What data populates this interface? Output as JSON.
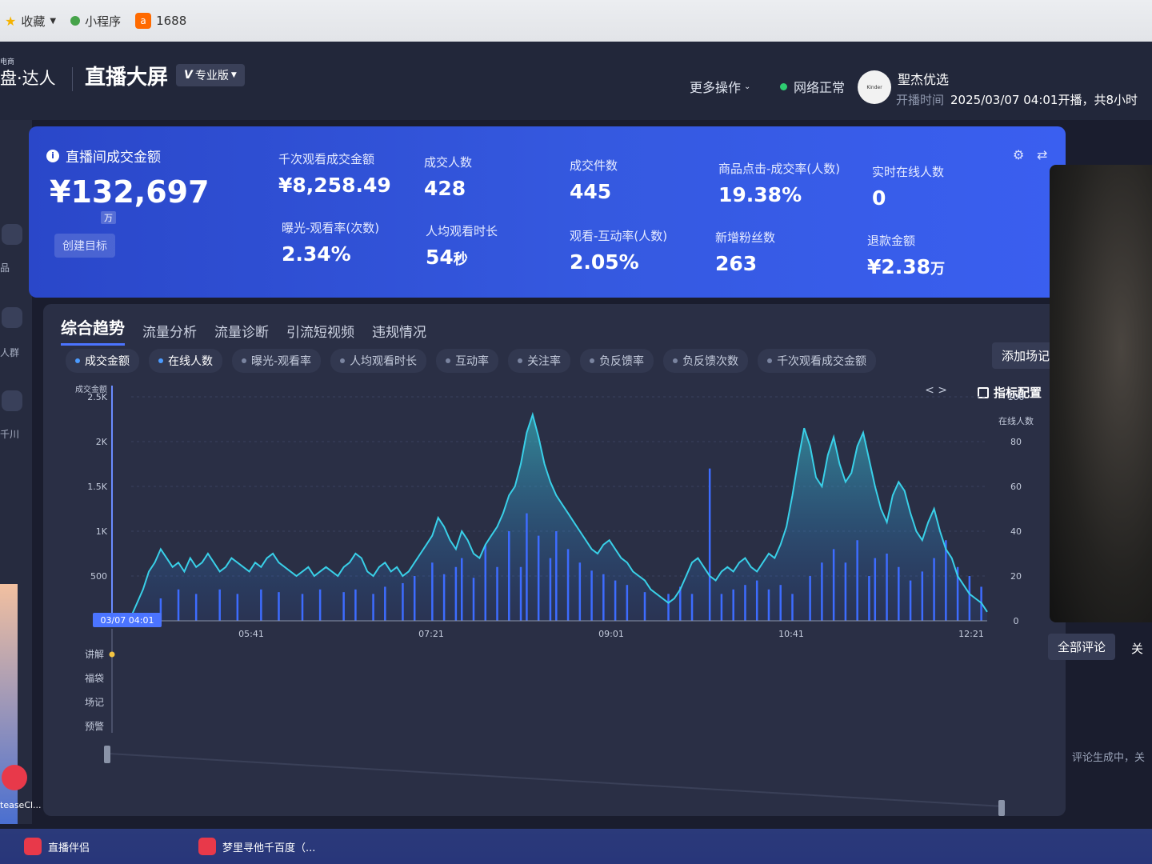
{
  "bookmarks": {
    "items": [
      {
        "label": "收藏",
        "icon": "star-icon"
      },
      {
        "label": "小程序",
        "icon": "mini-program-icon"
      },
      {
        "label": "1688",
        "icon": "1688-icon"
      }
    ]
  },
  "header": {
    "brand_small": "电商",
    "brand": "盘·达人",
    "title": "直播大屏",
    "edition": "专业版",
    "edition_v": "V",
    "more_ops": "更多操作",
    "net_status": "网络正常",
    "avatar_text": "Kinder",
    "shop_name": "聖杰优选",
    "live_time_label": "开播时间",
    "live_time_value": "2025/03/07 04:01开播，共8小时"
  },
  "left_rail": {
    "items": [
      "品",
      "人群",
      "千川"
    ]
  },
  "metrics": {
    "main_title": "直播间成交金额",
    "main_value": "¥132,697",
    "main_unit": "万",
    "create_goal": "创建目标",
    "items": [
      {
        "label": "千次观看成交金额",
        "value": "¥8,258.49"
      },
      {
        "label": "成交人数",
        "value": "428"
      },
      {
        "label": "成交件数",
        "value": "445"
      },
      {
        "label": "商品点击-成交率(人数)",
        "value": "19.38%"
      },
      {
        "label": "实时在线人数",
        "value": "0"
      },
      {
        "label": "曝光-观看率(次数)",
        "value": "2.34%"
      },
      {
        "label": "人均观看时长",
        "value": "54",
        "unit": "秒"
      },
      {
        "label": "观看-互动率(人数)",
        "value": "2.05%"
      },
      {
        "label": "新增粉丝数",
        "value": "263"
      },
      {
        "label": "退款金额",
        "value": "¥2.38",
        "unit": "万"
      }
    ]
  },
  "panel": {
    "tabs": [
      "综合趋势",
      "流量分析",
      "流量诊断",
      "引流短视频",
      "违规情况"
    ],
    "active_tab": 0,
    "add_record": "添加场记",
    "chips": [
      {
        "label": "成交金额",
        "on": true
      },
      {
        "label": "在线人数",
        "on": true
      },
      {
        "label": "曝光-观看率",
        "on": false
      },
      {
        "label": "人均观看时长",
        "on": false
      },
      {
        "label": "互动率",
        "on": false
      },
      {
        "label": "关注率",
        "on": false
      },
      {
        "label": "负反馈率",
        "on": false
      },
      {
        "label": "负反馈次数",
        "on": false
      },
      {
        "label": "千次观看成交金额",
        "on": false
      }
    ],
    "chip_nav": "< >",
    "indicator_config": "指标配置"
  },
  "chart_data": {
    "type": "line",
    "left_axis_label": "成交金额",
    "right_axis_label": "在线人数",
    "left_ticks": [
      "2.5K",
      "2K",
      "1.5K",
      "1K",
      "500"
    ],
    "right_ticks": [
      "100",
      "80",
      "60",
      "40",
      "20",
      "0"
    ],
    "ylim_left": [
      0,
      2500
    ],
    "ylim_right": [
      0,
      100
    ],
    "start_label": "03/07 04:01",
    "x_ticks": [
      "05:41",
      "07:21",
      "09:01",
      "10:41",
      "12:21"
    ],
    "timeline_rows": [
      "讲解",
      "福袋",
      "场记",
      "预警"
    ],
    "series": [
      {
        "name": "在线人数",
        "color": "#39d0e8",
        "values": [
          2,
          8,
          14,
          22,
          26,
          32,
          28,
          24,
          26,
          22,
          28,
          24,
          26,
          30,
          26,
          22,
          24,
          28,
          26,
          24,
          22,
          26,
          24,
          28,
          30,
          26,
          24,
          22,
          20,
          22,
          24,
          20,
          22,
          24,
          22,
          20,
          24,
          26,
          30,
          28,
          22,
          20,
          24,
          26,
          22,
          24,
          20,
          22,
          26,
          30,
          34,
          38,
          46,
          42,
          36,
          32,
          40,
          36,
          30,
          28,
          34,
          38,
          42,
          48,
          56,
          60,
          70,
          84,
          92,
          82,
          70,
          62,
          56,
          52,
          48,
          44,
          40,
          36,
          32,
          30,
          34,
          36,
          32,
          28,
          26,
          22,
          20,
          18,
          14,
          12,
          10,
          8,
          10,
          14,
          20,
          26,
          28,
          24,
          20,
          18,
          22,
          24,
          22,
          26,
          28,
          24,
          22,
          26,
          30,
          28,
          34,
          42,
          56,
          72,
          86,
          78,
          64,
          60,
          74,
          82,
          70,
          62,
          66,
          78,
          84,
          72,
          60,
          50,
          44,
          56,
          62,
          58,
          48,
          40,
          36,
          44,
          50,
          40,
          32,
          28,
          20,
          16,
          12,
          10,
          8,
          4
        ]
      },
      {
        "name": "成交金额",
        "color": "#3d6cff",
        "values": [
          0,
          0,
          0,
          0,
          0,
          250,
          0,
          0,
          350,
          0,
          0,
          300,
          0,
          0,
          0,
          350,
          0,
          0,
          300,
          0,
          0,
          0,
          350,
          0,
          0,
          320,
          0,
          0,
          0,
          300,
          0,
          0,
          350,
          0,
          0,
          0,
          320,
          0,
          350,
          0,
          0,
          300,
          0,
          380,
          0,
          0,
          420,
          0,
          500,
          0,
          0,
          650,
          0,
          520,
          0,
          600,
          700,
          0,
          480,
          0,
          850,
          0,
          600,
          0,
          1000,
          0,
          600,
          1200,
          0,
          950,
          0,
          700,
          1000,
          0,
          800,
          0,
          650,
          0,
          560,
          0,
          520,
          0,
          450,
          0,
          400,
          0,
          0,
          320,
          0,
          0,
          0,
          300,
          0,
          380,
          0,
          300,
          0,
          0,
          1700,
          0,
          300,
          0,
          350,
          0,
          400,
          0,
          450,
          0,
          350,
          0,
          400,
          0,
          300,
          0,
          0,
          500,
          0,
          650,
          0,
          800,
          0,
          650,
          0,
          900,
          0,
          500,
          700,
          0,
          750,
          0,
          600,
          0,
          450,
          0,
          550,
          0,
          700,
          0,
          900,
          0,
          600,
          0,
          500,
          0,
          380,
          0
        ]
      }
    ]
  },
  "right": {
    "all_comments": "全部评论",
    "follow_tab": "关",
    "comments_status": "评论生成中，关"
  },
  "taskbar": {
    "items": [
      "直播伴侣",
      "梦里寻他千百度（..."
    ],
    "desktop_label": "teaseCl..."
  }
}
